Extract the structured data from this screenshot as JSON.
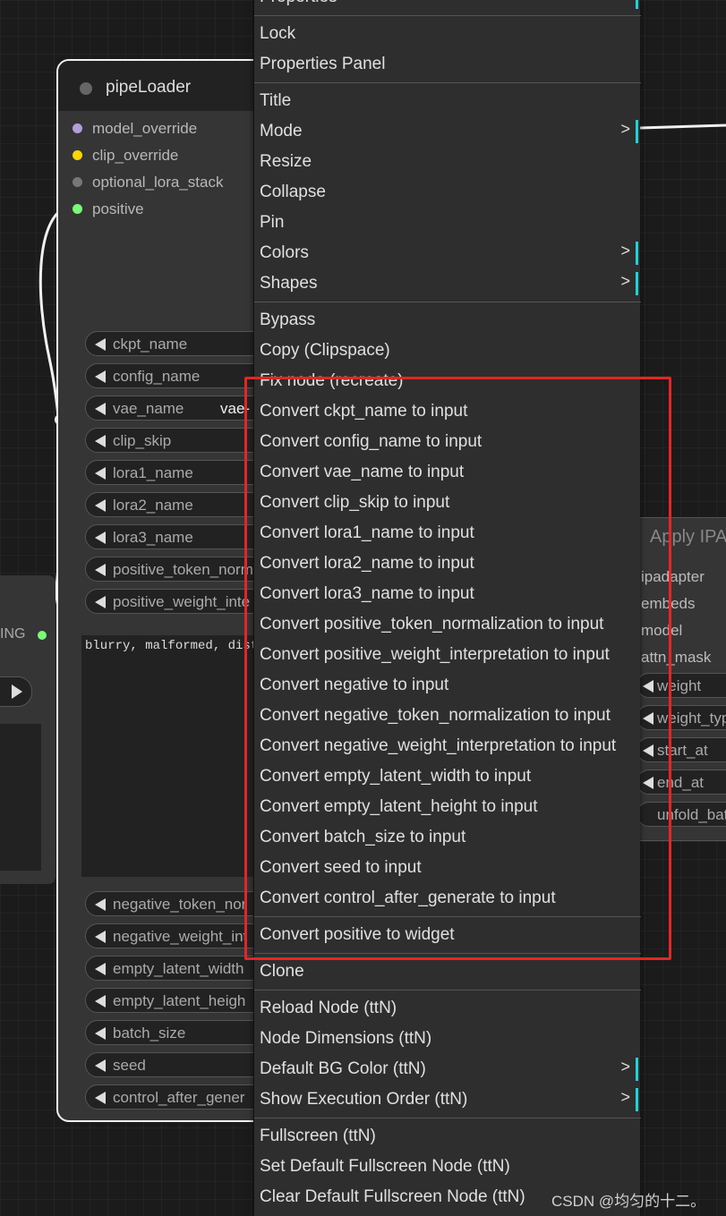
{
  "pipe_node": {
    "title": "pipeLoader",
    "inputs": [
      {
        "label": "model_override",
        "color": "#b39ddb"
      },
      {
        "label": "clip_override",
        "color": "#ffd500"
      },
      {
        "label": "optional_lora_stack",
        "color": "#777777"
      },
      {
        "label": "positive",
        "color": "#7f7"
      }
    ],
    "widgets": [
      {
        "label": "ckpt_name",
        "value": ""
      },
      {
        "label": "config_name",
        "value": ""
      },
      {
        "label": "vae_name",
        "value": "vae-"
      },
      {
        "label": "clip_skip",
        "value": ""
      },
      {
        "label": "lora1_name",
        "value": ""
      },
      {
        "label": "lora2_name",
        "value": ""
      },
      {
        "label": "lora3_name",
        "value": ""
      },
      {
        "label": "positive_token_norm",
        "value": ""
      },
      {
        "label": "positive_weight_inte",
        "value": ""
      }
    ],
    "text_value": "blurry, malformed, dist",
    "widgets_bottom": [
      {
        "label": "negative_token_nor",
        "value": ""
      },
      {
        "label": "negative_weight_int",
        "value": ""
      },
      {
        "label": "empty_latent_width",
        "value": ""
      },
      {
        "label": "empty_latent_heigh",
        "value": ""
      },
      {
        "label": "batch_size",
        "value": ""
      },
      {
        "label": "seed",
        "value": ""
      },
      {
        "label": "control_after_gener",
        "value": ""
      }
    ]
  },
  "left_node": {
    "output_label": "ING"
  },
  "ipa_node": {
    "title": "Apply IPA",
    "inputs": [
      "ipadapter",
      "embeds",
      "model",
      "attn_mask"
    ],
    "widgets": [
      "weight",
      "weight_typ",
      "start_at",
      "end_at",
      "unfold_batc"
    ]
  },
  "menu": {
    "groups": [
      [
        {
          "label": "Properties",
          "submenu": true
        }
      ],
      [
        {
          "label": "Lock"
        },
        {
          "label": "Properties Panel"
        }
      ],
      [
        {
          "label": "Title"
        },
        {
          "label": "Mode",
          "submenu": true
        },
        {
          "label": "Resize"
        },
        {
          "label": "Collapse"
        },
        {
          "label": "Pin"
        },
        {
          "label": "Colors",
          "submenu": true
        },
        {
          "label": "Shapes",
          "submenu": true
        }
      ],
      [
        {
          "label": "Bypass"
        },
        {
          "label": "Copy (Clipspace)"
        },
        {
          "label": "Fix node (recreate)"
        },
        {
          "label": "Convert ckpt_name to input"
        },
        {
          "label": "Convert config_name to input"
        },
        {
          "label": "Convert vae_name to input"
        },
        {
          "label": "Convert clip_skip to input"
        },
        {
          "label": "Convert lora1_name to input"
        },
        {
          "label": "Convert lora2_name to input"
        },
        {
          "label": "Convert lora3_name to input"
        },
        {
          "label": "Convert positive_token_normalization to input"
        },
        {
          "label": "Convert positive_weight_interpretation to input"
        },
        {
          "label": "Convert negative to input"
        },
        {
          "label": "Convert negative_token_normalization to input"
        },
        {
          "label": "Convert negative_weight_interpretation to input"
        },
        {
          "label": "Convert empty_latent_width to input"
        },
        {
          "label": "Convert empty_latent_height to input"
        },
        {
          "label": "Convert batch_size to input"
        },
        {
          "label": "Convert seed to input"
        },
        {
          "label": "Convert control_after_generate to input"
        }
      ],
      [
        {
          "label": "Convert positive to widget"
        }
      ],
      [
        {
          "label": "Clone"
        }
      ],
      [
        {
          "label": "Reload Node (ttN)"
        },
        {
          "label": "Node Dimensions (ttN)"
        },
        {
          "label": "Default BG Color (ttN)",
          "submenu": true
        },
        {
          "label": "Show Execution Order (ttN)",
          "submenu": true
        }
      ],
      [
        {
          "label": "Fullscreen (ttN)"
        },
        {
          "label": "Set Default Fullscreen Node (ttN)"
        },
        {
          "label": "Clear Default Fullscreen Node (ttN)"
        }
      ]
    ],
    "submenu_glyph": ">",
    "accent": "#1fd4d4"
  },
  "highlight_color": "#e62525",
  "watermark": "CSDN @均匀的十二。"
}
